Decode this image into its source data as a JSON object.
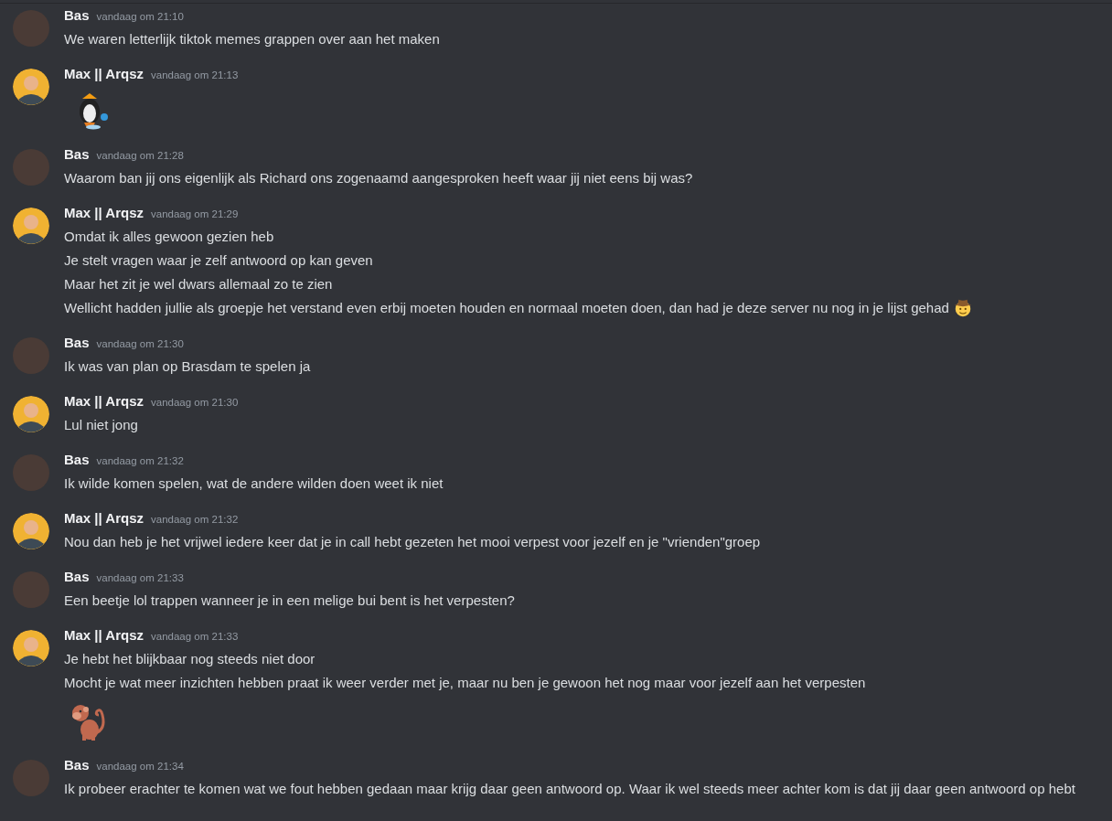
{
  "messages": [
    {
      "author": "Bas",
      "kind": "photo",
      "time": "vandaag om 21:10",
      "lines": [
        {
          "kind": "text",
          "text": "We waren letterlijk tiktok memes grappen over aan het maken"
        }
      ]
    },
    {
      "author": "Max || Arqsz",
      "kind": "cartoon",
      "time": "vandaag om 21:13",
      "lines": [
        {
          "kind": "penguin"
        }
      ]
    },
    {
      "author": "Bas",
      "kind": "photo",
      "time": "vandaag om 21:28",
      "lines": [
        {
          "kind": "text",
          "text": "Waarom ban jij ons eigenlijk als Richard ons zogenaamd aangesproken heeft waar jij niet eens bij was?"
        }
      ]
    },
    {
      "author": "Max || Arqsz",
      "kind": "cartoon",
      "time": "vandaag om 21:29",
      "lines": [
        {
          "kind": "text",
          "text": "Omdat ik alles gewoon gezien heb"
        },
        {
          "kind": "text",
          "text": "Je stelt vragen waar je zelf antwoord op kan geven"
        },
        {
          "kind": "text",
          "text": "Maar het zit je wel dwars allemaal zo te zien"
        },
        {
          "kind": "cowboy",
          "text": "Wellicht hadden jullie als groepje het verstand even erbij moeten houden en normaal moeten doen, dan had je deze server nu nog in je lijst gehad"
        }
      ]
    },
    {
      "author": "Bas",
      "kind": "photo",
      "time": "vandaag om 21:30",
      "lines": [
        {
          "kind": "text",
          "text": "Ik was van plan op Brasdam te spelen ja"
        }
      ]
    },
    {
      "author": "Max || Arqsz",
      "kind": "cartoon",
      "time": "vandaag om 21:30",
      "lines": [
        {
          "kind": "text",
          "text": "Lul niet jong"
        }
      ]
    },
    {
      "author": "Bas",
      "kind": "photo",
      "time": "vandaag om 21:32",
      "lines": [
        {
          "kind": "text",
          "text": "Ik wilde komen spelen, wat de andere wilden doen weet ik niet"
        }
      ]
    },
    {
      "author": "Max || Arqsz",
      "kind": "cartoon",
      "time": "vandaag om 21:32",
      "lines": [
        {
          "kind": "text",
          "text": "Nou dan heb je het vrijwel iedere keer dat je in call hebt gezeten het mooi verpest voor jezelf en je \"vrienden\"groep"
        }
      ]
    },
    {
      "author": "Bas",
      "kind": "photo",
      "time": "vandaag om 21:33",
      "lines": [
        {
          "kind": "text",
          "text": "Een beetje lol trappen wanneer je in een melige bui bent is het verpesten?"
        }
      ]
    },
    {
      "author": "Max || Arqsz",
      "kind": "cartoon",
      "time": "vandaag om 21:33",
      "lines": [
        {
          "kind": "text",
          "text": "Je hebt het blijkbaar nog steeds niet door"
        },
        {
          "kind": "text",
          "text": "Mocht je wat meer inzichten hebben praat ik weer verder met je, maar nu ben je gewoon het nog maar voor jezelf aan het verpesten"
        },
        {
          "kind": "monkey"
        }
      ]
    },
    {
      "author": "Bas",
      "kind": "photo",
      "time": "vandaag om 21:34",
      "lines": [
        {
          "kind": "text",
          "text": "Ik probeer erachter te komen wat we fout hebben gedaan maar krijg daar geen antwoord op. Waar ik wel steeds meer achter kom is dat jij daar geen antwoord op hebt"
        }
      ]
    }
  ]
}
